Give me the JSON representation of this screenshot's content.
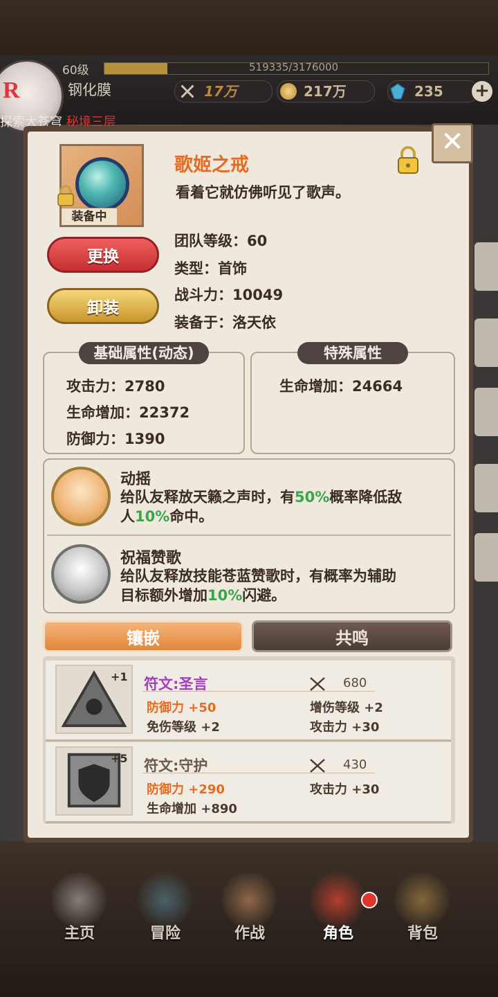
{
  "hud": {
    "level": "60级",
    "exp": "519335/3176000",
    "exp_fraction": 0.1635,
    "player_name": "钢化膜",
    "power": "17万",
    "gold": "217万",
    "gems": "235",
    "quest_prefix": "探索大苍穹",
    "quest_highlight": "秘境三层",
    "avatar_letter": "R"
  },
  "item": {
    "name": "歌姬之戒",
    "description": "看着它就仿佛听见了歌声。",
    "equipped_tag": "装备中",
    "team_level": "团队等级：60",
    "type": "类型：首饰",
    "combat_power": "战斗力：10049",
    "equipped_to": "装备于：洛天依",
    "replace_button": "更换",
    "unequip_button": "卸装"
  },
  "base_attrs": {
    "title": "基础属性(动态)",
    "attack": "攻击力：2780",
    "hp": "生命增加：22372",
    "defense": "防御力：1390"
  },
  "special_attrs": {
    "title": "特殊属性",
    "hp": "生命增加：24664"
  },
  "skills": [
    {
      "name": "动摇",
      "line1_a": "给队友释放天籁之声时，有",
      "line1_green": "50%",
      "line1_b": "概率降低敌",
      "line2_a": "人",
      "line2_green": "10%",
      "line2_b": "命中。"
    },
    {
      "name": "祝福赞歌",
      "line1": "给队友释放技能苍蓝赞歌时，有概率为辅助",
      "line2_a": "目标额外增加",
      "line2_green": "10%",
      "line2_b": "闪避。"
    }
  ],
  "tabs": {
    "inlay": "镶嵌",
    "resonance": "共鸣"
  },
  "runes": [
    {
      "plus": "+1",
      "name": "符文:圣言",
      "name_color": "#a23fc0",
      "power": "680",
      "stat1": "防御力 +50",
      "stat2": "免伤等级 +2",
      "stat3": "增伤等级 +2",
      "stat4": "攻击力 +30"
    },
    {
      "plus": "+5",
      "name": "符文:守护",
      "name_color": "#6a5a4c",
      "power": "430",
      "stat1": "防御力 +290",
      "stat2": "生命增加 +890",
      "stat3": "攻击力 +30"
    }
  ],
  "nav": [
    {
      "label": "主页",
      "color": "#c9c3bd"
    },
    {
      "label": "冒险",
      "color": "#5e8fa3"
    },
    {
      "label": "作战",
      "color": "#d99a6a"
    },
    {
      "label": "角色",
      "color": "#c0402f",
      "badge": true
    },
    {
      "label": "背包",
      "color": "#c49a4e"
    }
  ],
  "close_symbol": "✕"
}
